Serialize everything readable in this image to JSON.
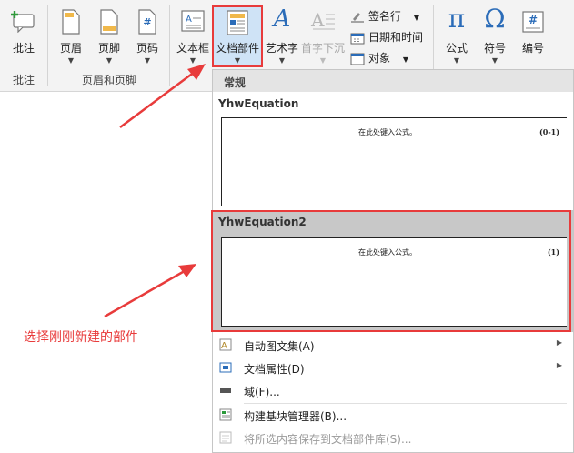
{
  "ribbon": {
    "groups": [
      {
        "label": "批注"
      },
      {
        "label": "页眉和页脚"
      }
    ],
    "buttons": {
      "comment": "批注",
      "header": "页眉",
      "footer": "页脚",
      "page_number": "页码",
      "textbox": "文本框",
      "quick_parts": "文档部件",
      "wordart": "艺术字",
      "drop_cap": "首字下沉",
      "signature_line": "签名行",
      "date_time": "日期和时间",
      "object": "对象",
      "equation": "公式",
      "symbol": "符号",
      "number": "编号"
    },
    "icons": {
      "symbol_glyph": "Ω",
      "equation_glyph": "π",
      "number_glyph": "#",
      "page_number_glyph": "#",
      "wordart_glyph": "A"
    }
  },
  "dropdown": {
    "section_header": "常规",
    "gallery": [
      {
        "title": "YhwEquation",
        "preview_text": "在此处键入公式。",
        "preview_number": "(0-1)"
      },
      {
        "title": "YhwEquation2",
        "preview_text": "在此处键入公式。",
        "preview_number": "(1)"
      }
    ],
    "menu": [
      {
        "label": "自动图文集(A)",
        "has_submenu": true,
        "disabled": false,
        "icon": "autotext-icon"
      },
      {
        "label": "文档属性(D)",
        "has_submenu": true,
        "disabled": false,
        "icon": "document-property-icon"
      },
      {
        "label": "域(F)...",
        "has_submenu": false,
        "disabled": false,
        "icon": "field-icon"
      },
      {
        "label": "构建基块管理器(B)...",
        "has_submenu": false,
        "disabled": false,
        "icon": "building-blocks-icon"
      },
      {
        "label": "将所选内容保存到文档部件库(S)...",
        "has_submenu": false,
        "disabled": true,
        "icon": "save-selection-icon"
      }
    ]
  },
  "annotation": {
    "text": "选择刚刚新建的部件",
    "color": "#e83b3b"
  },
  "colors": {
    "highlight_border": "#e83b3b",
    "selected_bg": "#c8c8c8",
    "ribbon_bg": "#f3f3f3",
    "accent_blue": "#2b6cb8"
  }
}
